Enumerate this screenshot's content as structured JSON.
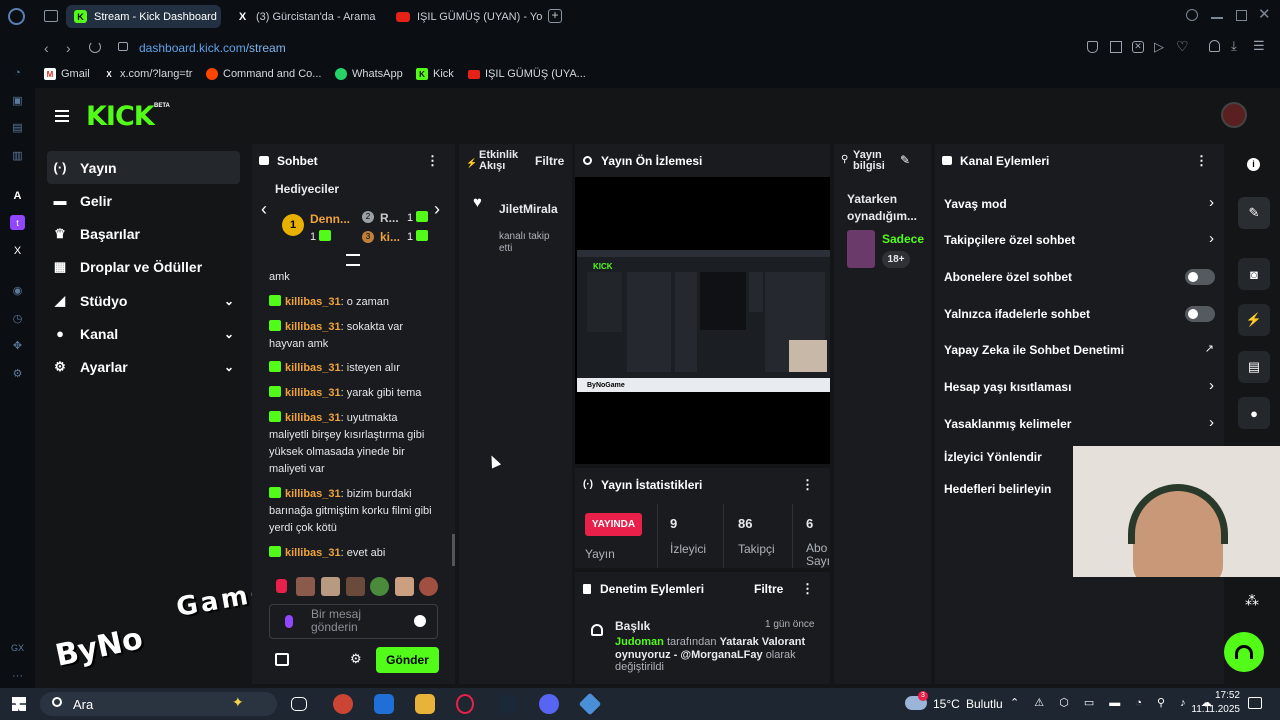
{
  "browser": {
    "tabs": [
      {
        "label": "Stream - Kick Dashboard",
        "active": true
      },
      {
        "label": "(3) Gürcistan'da - Arama",
        "active": false
      },
      {
        "label": "IŞIL GÜMÜŞ (UYAN) - You",
        "active": false
      }
    ],
    "url_host": "dashboard.kick.com",
    "url_path": "/stream",
    "bookmarks": [
      "Gmail",
      "x.com/?lang=tr",
      "Command and Co...",
      "WhatsApp",
      "Kick",
      "IŞIL GÜMÜŞ (UYA..."
    ]
  },
  "kick": {
    "logo": "KICK",
    "logo_badge": "BETA",
    "accent": "#53fc18"
  },
  "sidebar": {
    "items": [
      {
        "label": "Yayın",
        "icon": "broadcast-icon"
      },
      {
        "label": "Gelir",
        "icon": "money-icon"
      },
      {
        "label": "Başarılar",
        "icon": "trophy-icon"
      },
      {
        "label": "Droplar ve Ödüller",
        "icon": "gift-icon"
      },
      {
        "label": "Stüdyo",
        "icon": "studio-icon"
      },
      {
        "label": "Kanal",
        "icon": "user-icon"
      },
      {
        "label": "Ayarlar",
        "icon": "gear-icon"
      }
    ]
  },
  "chat": {
    "title": "Sohbet",
    "gifters_title": "Hediyeciler",
    "gifters": [
      {
        "rank": "1",
        "name": "Denn...",
        "count": "1"
      },
      {
        "rank": "2",
        "name": "R...",
        "count": "1"
      },
      {
        "rank": "3",
        "name": "ki...",
        "count": "1"
      }
    ],
    "messages": [
      {
        "user": "",
        "text": "amk"
      },
      {
        "user": "killibas_31",
        "text": "o zaman"
      },
      {
        "user": "killibas_31",
        "text": "sokakta var hayvan amk"
      },
      {
        "user": "killibas_31",
        "text": "isteyen alır"
      },
      {
        "user": "killibas_31",
        "text": "yarak gibi tema"
      },
      {
        "user": "killibas_31",
        "text": "uyutmakta maliyetli birşey kısırlaştırma gibi yüksek olmasada yinede bir maliyeti var"
      },
      {
        "user": "killibas_31",
        "text": "bizim burdaki barınağa gitmiştim korku filmi gibi yerdi çok kötü"
      },
      {
        "user": "killibas_31",
        "text": "evet abi"
      }
    ],
    "input_placeholder": "Bir mesaj gönderin",
    "send_label": "Gönder"
  },
  "activity": {
    "title": "Etkinlik Akışı",
    "filter_label": "Filtre",
    "event_user": "JiletMirala",
    "event_text": "kanalı takip etti"
  },
  "preview": {
    "title": "Yayın Ön İzlemesi"
  },
  "stats": {
    "title": "Yayın İstatistikleri",
    "live_badge": "YAYINDA",
    "live_label": "Yayın",
    "items": [
      {
        "value": "9",
        "label": "İzleyici"
      },
      {
        "value": "86",
        "label": "Takipçi"
      },
      {
        "value": "6",
        "label": "Abo Sayı"
      }
    ]
  },
  "moderation": {
    "title": "Denetim Eylemleri",
    "filter_label": "Filtre",
    "entry_title": "Başlık",
    "entry_time": "1 gün önce",
    "entry_user": "Judoman",
    "entry_mid": "tarafından",
    "entry_text": "Yatarak Valorant oynuyoruz - @MorganaLFay",
    "entry_suffix": "olarak değiştirildi"
  },
  "stream_info": {
    "title": "Yayın bilgisi",
    "playing": "Yatarken oynadığım...",
    "category": "Sadece",
    "age_badge": "18+"
  },
  "channel_actions": {
    "title": "Kanal Eylemleri",
    "items": [
      {
        "label": "Yavaş mod",
        "control": "chevron"
      },
      {
        "label": "Takipçilere özel sohbet",
        "control": "chevron"
      },
      {
        "label": "Abonelere özel sohbet",
        "control": "toggle"
      },
      {
        "label": "Yalnızca ifadelerle sohbet",
        "control": "toggle"
      },
      {
        "label": "Yapay Zeka ile Sohbet Denetimi",
        "control": "external"
      },
      {
        "label": "Hesap yaşı kısıtlaması",
        "control": "chevron"
      },
      {
        "label": "Yasaklanmış kelimeler",
        "control": "chevron"
      },
      {
        "label": "İzleyici Yönlendir",
        "control": "none"
      },
      {
        "label": "Hedefleri belirleyin",
        "control": "none"
      }
    ]
  },
  "watermark": {
    "text_top": "Game",
    "text_bottom": "ByNo"
  },
  "taskbar": {
    "search_label": "Ara",
    "weather_temp": "15°C",
    "weather_text": "Bulutlu",
    "time": "17:52",
    "date": "11.11.2025",
    "weather_badge": "3"
  }
}
